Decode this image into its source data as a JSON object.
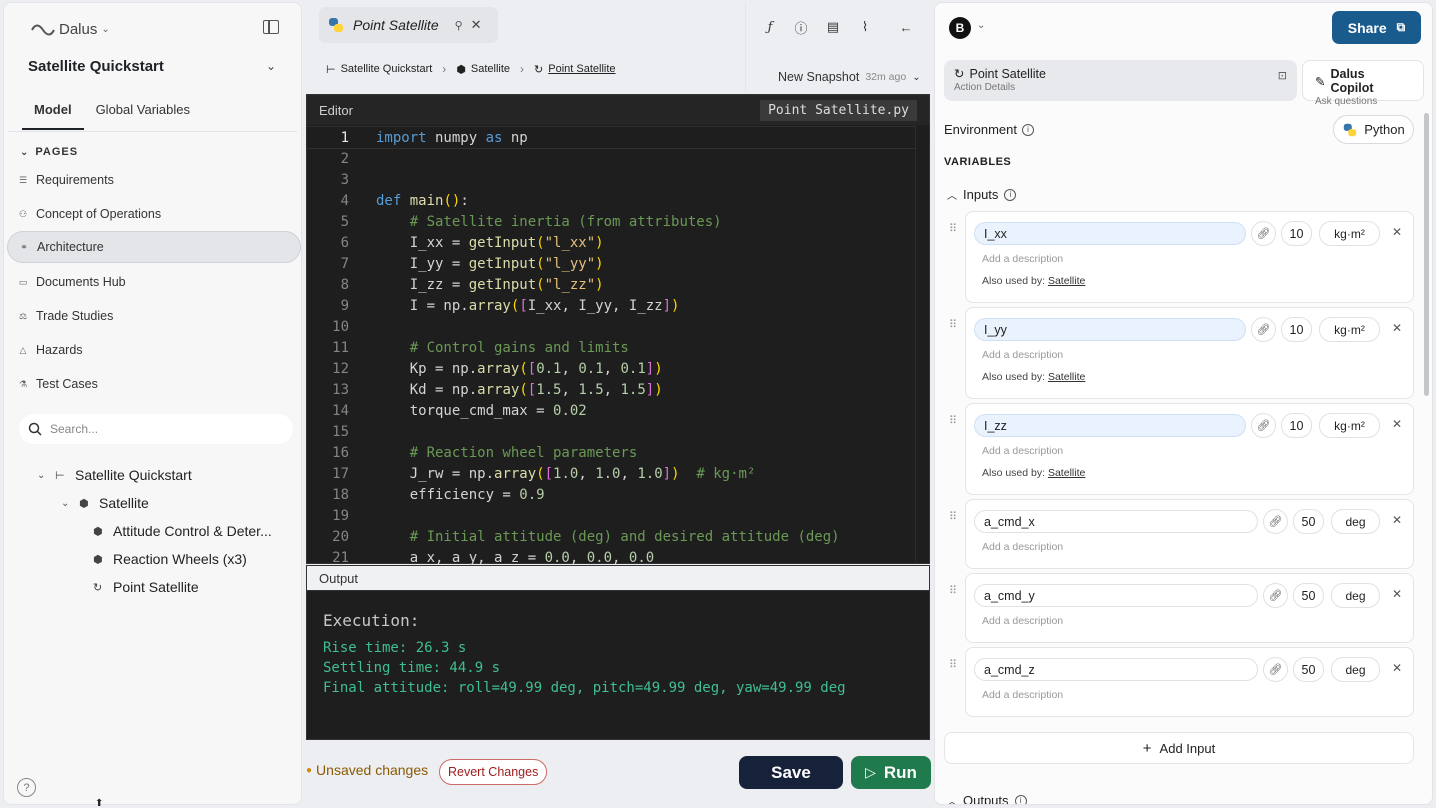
{
  "sidebar": {
    "logo": "Dalus",
    "project_title": "Satellite Quickstart",
    "tabs": [
      "Model",
      "Global Variables"
    ],
    "pages_header": "PAGES",
    "pages": [
      {
        "label": "Requirements",
        "icon": "list-icon"
      },
      {
        "label": "Concept of Operations",
        "icon": "people-icon"
      },
      {
        "label": "Architecture",
        "icon": "architecture-icon",
        "active": true
      },
      {
        "label": "Documents Hub",
        "icon": "folder-icon"
      },
      {
        "label": "Trade Studies",
        "icon": "scale-icon"
      },
      {
        "label": "Hazards",
        "icon": "hazard-icon"
      },
      {
        "label": "Test Cases",
        "icon": "flask-icon"
      }
    ],
    "search_placeholder": "Search...",
    "tree": [
      {
        "label": "Satellite Quickstart",
        "level": 0,
        "icon": "hierarchy-icon"
      },
      {
        "label": "Satellite",
        "level": 1,
        "icon": "cube-icon"
      },
      {
        "label": "Attitude Control & Deter...",
        "level": 2,
        "icon": "cube-icon"
      },
      {
        "label": "Reaction Wheels (x3)",
        "level": 2,
        "icon": "cube-icon"
      },
      {
        "label": "Point Satellite",
        "level": 2,
        "icon": "action-icon"
      }
    ]
  },
  "center": {
    "file_tab": "Point Satellite",
    "breadcrumbs": [
      "Satellite Quickstart",
      "Satellite",
      "Point Satellite"
    ],
    "snapshot": "New Snapshot",
    "snapshot_ago": "32m ago",
    "editor_label": "Editor",
    "editor_file": "Point Satellite.py",
    "code_lines": [
      "1",
      "2",
      "3",
      "4",
      "5",
      "6",
      "7",
      "8",
      "9",
      "10",
      "11",
      "12",
      "13",
      "14",
      "15",
      "16",
      "17",
      "18",
      "19",
      "20",
      "21"
    ],
    "output_label": "Output",
    "output_title": "Execution:",
    "output_lines": [
      "Rise time: 26.3 s",
      "Settling time: 44.9 s",
      "Final attitude: roll=49.99 deg, pitch=49.99 deg, yaw=49.99 deg"
    ],
    "unsaved": "Unsaved changes",
    "revert": "Revert Changes",
    "save": "Save",
    "run": "Run"
  },
  "right": {
    "avatar": "B",
    "share": "Share",
    "action_title": "Point Satellite",
    "action_sub": "Action Details",
    "copilot_title": "Dalus Copilot",
    "copilot_sub": "Ask questions",
    "environment": "Environment",
    "env_value": "Python",
    "variables": "VARIABLES",
    "inputs_label": "Inputs",
    "inputs": [
      {
        "name": "I_xx",
        "value": "10",
        "unit": "kg·m²",
        "desc": "Add a description",
        "also_prefix": "Also used by:",
        "also": "Satellite"
      },
      {
        "name": "I_yy",
        "value": "10",
        "unit": "kg·m²",
        "desc": "Add a description",
        "also_prefix": "Also used by:",
        "also": "Satellite"
      },
      {
        "name": "I_zz",
        "value": "10",
        "unit": "kg·m²",
        "desc": "Add a description",
        "also_prefix": "Also used by:",
        "also": "Satellite"
      },
      {
        "name": "a_cmd_x",
        "value": "50",
        "unit": "deg",
        "desc": "Add a description"
      },
      {
        "name": "a_cmd_y",
        "value": "50",
        "unit": "deg",
        "desc": "Add a description"
      },
      {
        "name": "a_cmd_z",
        "value": "50",
        "unit": "deg",
        "desc": "Add a description"
      }
    ],
    "add_input": "Add Input",
    "outputs_label": "Outputs"
  },
  "colors": {
    "share": "#1a5b8e",
    "save": "#16213a",
    "run": "#1f7a4c",
    "unsaved": "#8a5a00"
  }
}
